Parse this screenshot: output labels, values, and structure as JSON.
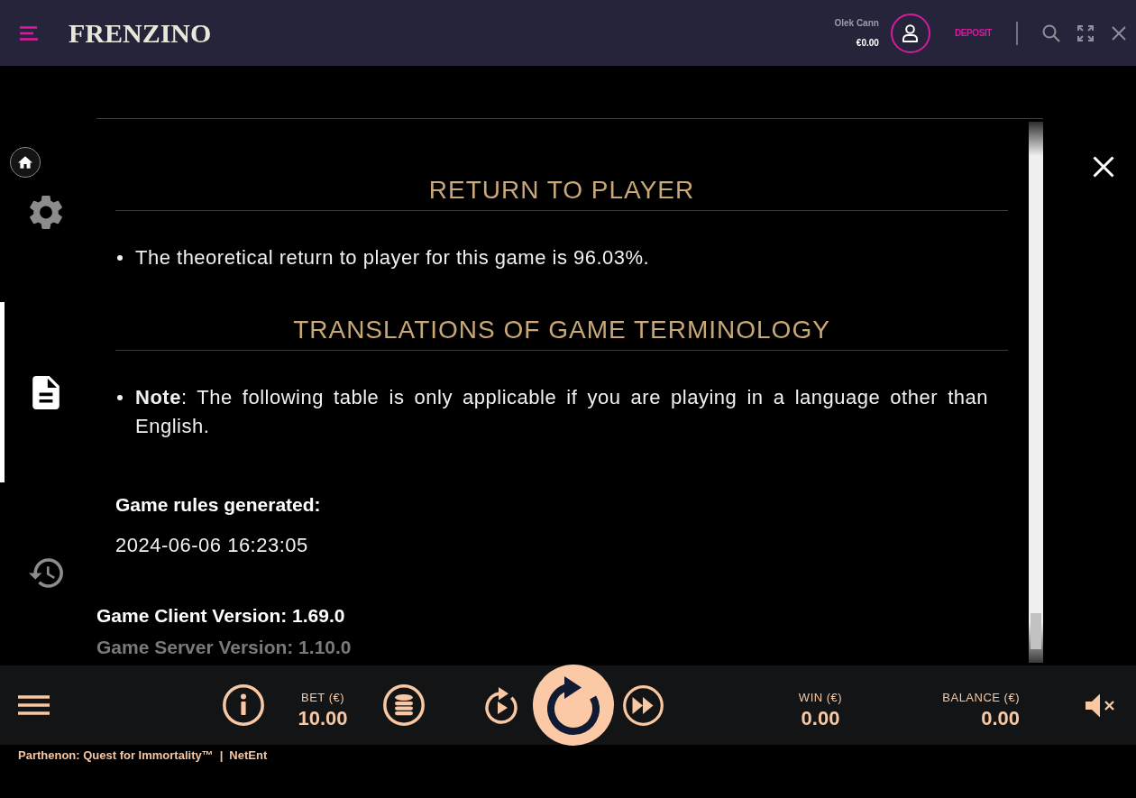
{
  "header": {
    "logo": "FRENZINO",
    "account": {
      "name": "Olek Cann",
      "balance": "€0.00"
    },
    "deposit_button": "DEPOSIT"
  },
  "side_menu": {
    "items": [
      {
        "kind": "settings",
        "selected": false
      },
      {
        "kind": "rules",
        "selected": true
      },
      {
        "kind": "history",
        "selected": false
      }
    ]
  },
  "game_rules": {
    "sections": [
      {
        "heading": "RETURN TO PLAYER",
        "bullets": [
          "The theoretical return to player for this game is 96.03%."
        ]
      },
      {
        "heading": "TRANSLATIONS OF GAME TERMINOLOGY",
        "bullets": [
          "**Note**: The following table is only applicable if you are playing in a language other than English."
        ]
      }
    ],
    "generated": {
      "label": "Game rules generated:",
      "value": "2024-06-06 16:23:05"
    },
    "versions": [
      {
        "text": "Game Client Version: 1.69.0",
        "faded": false
      },
      {
        "text": "Game Server Version: 1.10.0",
        "faded": true
      }
    ]
  },
  "control_bar": {
    "bet": {
      "label": "BET (€)",
      "value": "10.00"
    },
    "win": {
      "label": "WIN (€)",
      "value": "0.00"
    },
    "balance": {
      "label": "BALANCE (€)",
      "value": "0.00"
    },
    "sound_muted": true
  },
  "footer": {
    "game_title": "Parthenon: Quest for Immortality™",
    "separator": "|",
    "provider": "NetEnt"
  }
}
